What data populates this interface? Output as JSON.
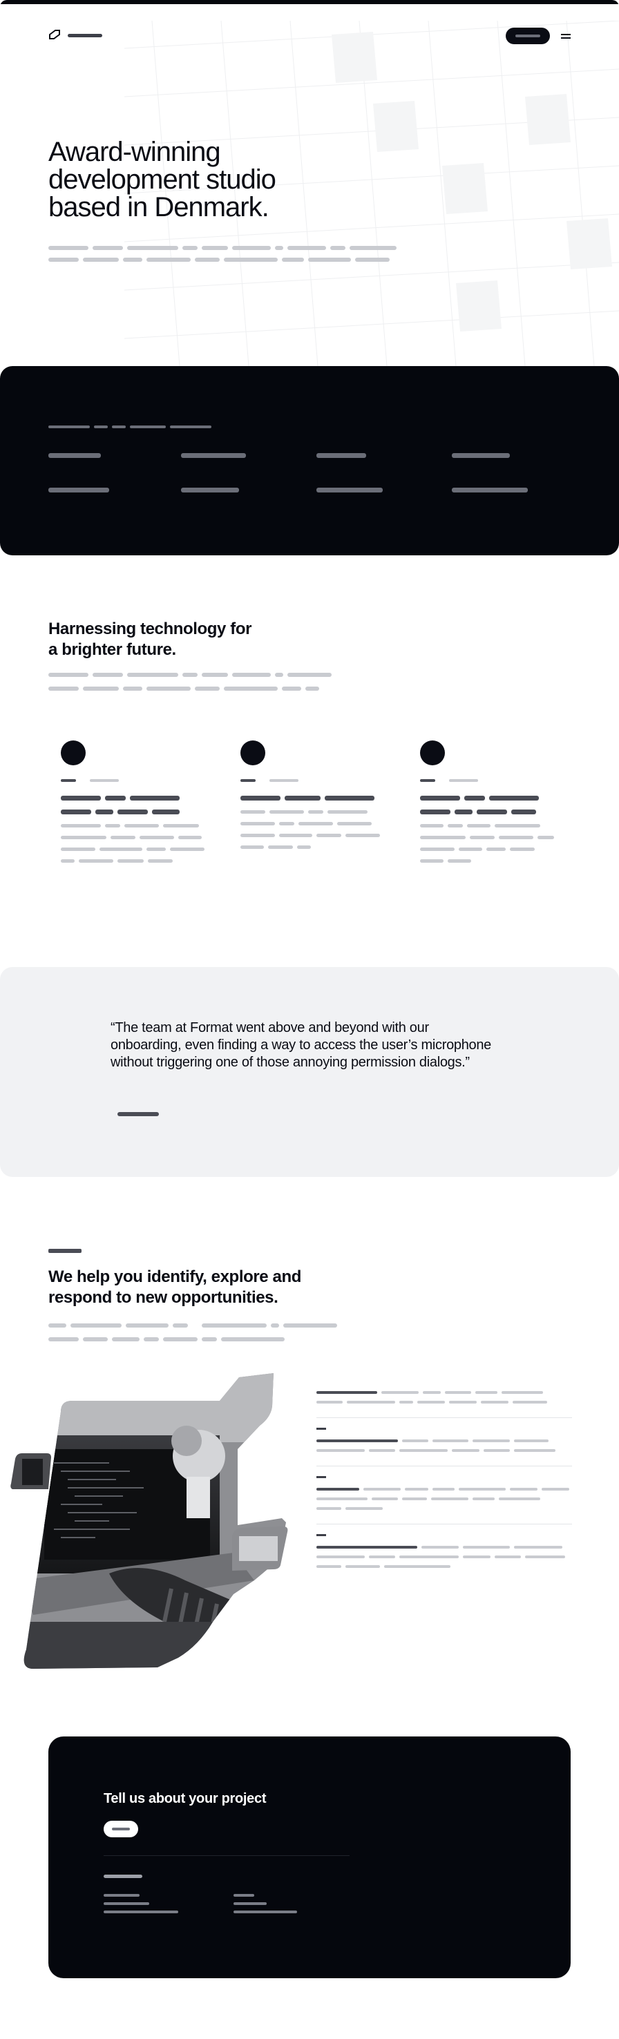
{
  "hero": {
    "title": "Award-winning development studio based in Denmark."
  },
  "section_tech": {
    "title": "Harnessing technology for a brighter future."
  },
  "testimonial": {
    "quote": "“The team at Format went above and beyond with our onboarding, even finding a way to access the user’s microphone without triggering one of those annoying permission dialogs.”"
  },
  "section_opportunities": {
    "title": "We help you identify, explore and respond to new opportunities."
  },
  "cta": {
    "title": "Tell us about your project"
  },
  "icons": [
    "logo-icon",
    "menu-icon"
  ],
  "colors": {
    "dark": "#05070d",
    "text": "#0a0c14",
    "placeholder_light": "#c9cbd0",
    "placeholder_dark": "#4a4c55",
    "quote_bg": "#f1f2f4"
  }
}
